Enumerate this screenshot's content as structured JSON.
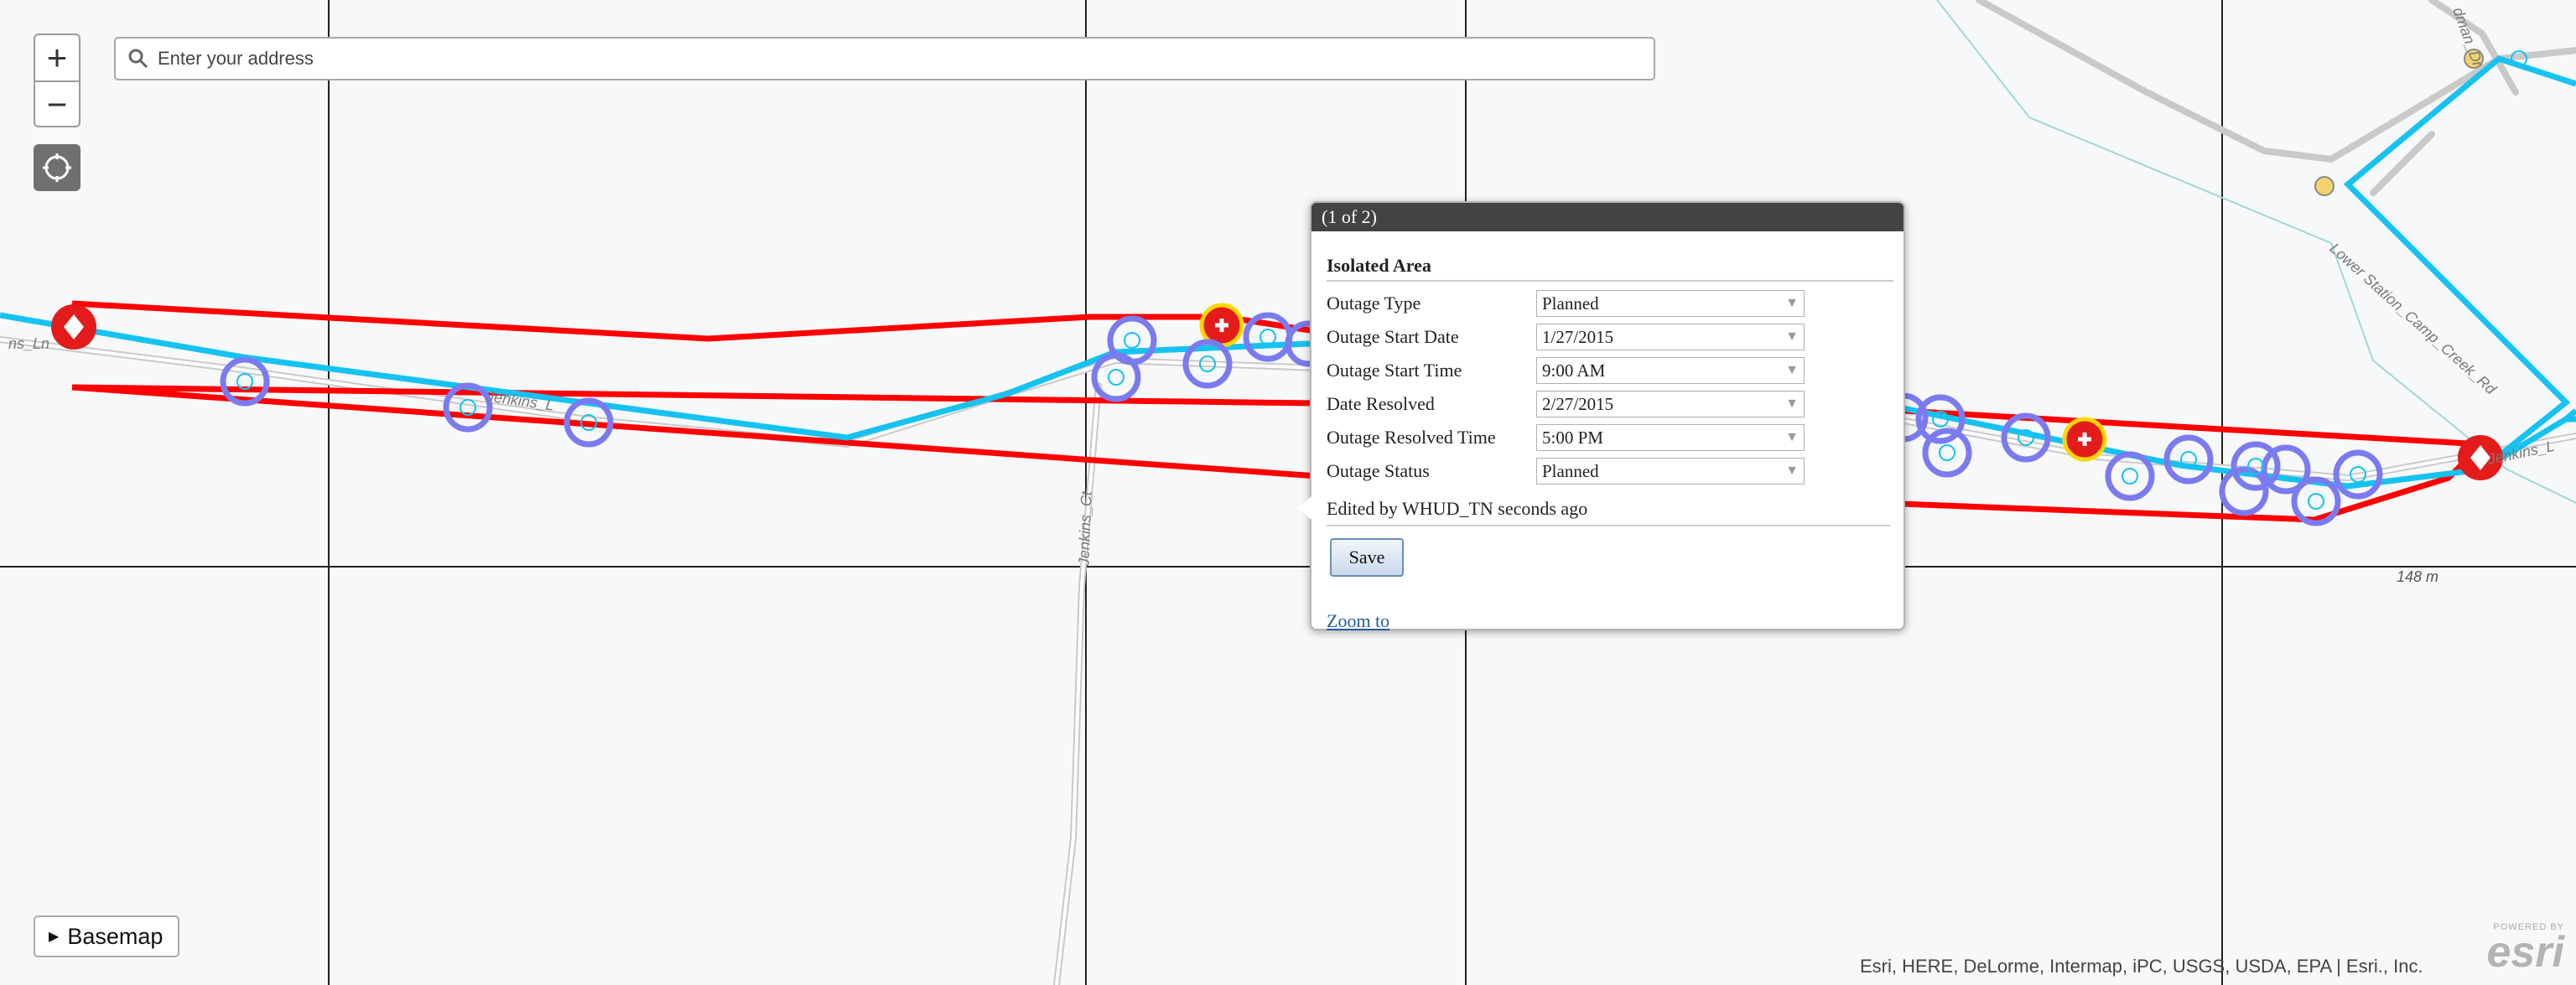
{
  "search": {
    "placeholder": "Enter your address"
  },
  "controls": {
    "zoom_in": "+",
    "zoom_out": "−"
  },
  "popup": {
    "counter": "(1 of 2)",
    "title": "Isolated Area",
    "fields": [
      {
        "label": "Outage Type",
        "value": "Planned"
      },
      {
        "label": "Outage Start Date",
        "value": "1/27/2015"
      },
      {
        "label": "Outage Start Time",
        "value": "9:00 AM"
      },
      {
        "label": "Date Resolved",
        "value": "2/27/2015"
      },
      {
        "label": "Outage Resolved Time",
        "value": "5:00 PM"
      },
      {
        "label": "Outage Status",
        "value": "Planned"
      }
    ],
    "edited_by": "Edited by WHUD_TN seconds ago",
    "save_label": "Save",
    "zoom_to_label": "Zoom to"
  },
  "basemap_label": "Basemap",
  "attribution": "Esri, HERE, DeLorme, Intermap, iPC, USGS, USDA, EPA | Esri., Inc.",
  "scale_label": "148 m",
  "map_labels": {
    "road_left": "ns_Ln",
    "road_jenkins": "Jenkins_L",
    "road_jenkins_ct": "Jenkins_Ct",
    "road_station": "Lower Station_Camp_Creek_Rd",
    "road_jenkins_right": "Jenkins_L",
    "road_top": "dman_Dr"
  },
  "esri": {
    "powered": "POWERED BY",
    "name": "esri"
  },
  "colors": {
    "outage_outline": "#ff0000",
    "line": "#16c2f0",
    "meter": "#7b7bef",
    "device": "#e31b1b"
  }
}
